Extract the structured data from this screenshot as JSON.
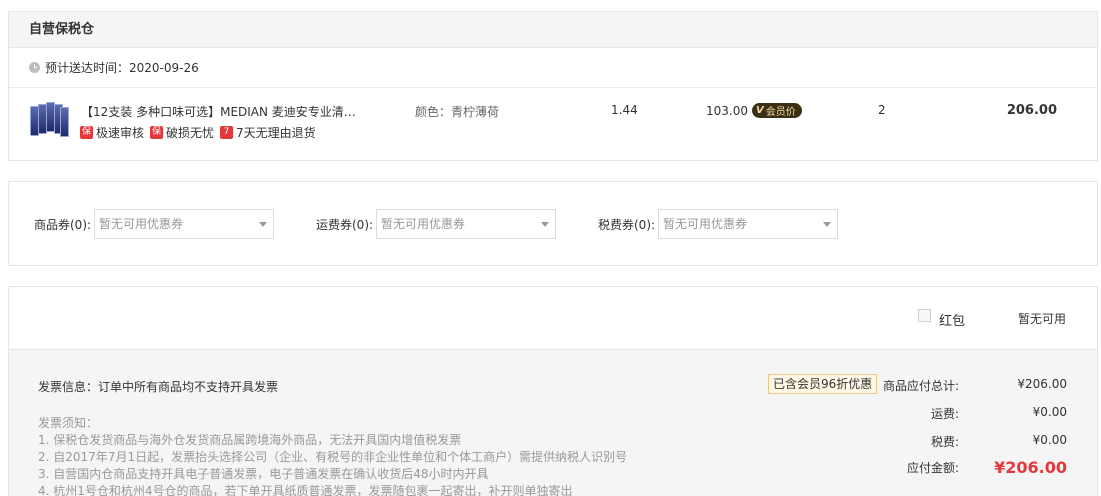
{
  "warehouse": {
    "title": "自营保税仓",
    "delivery_label": "预计送达时间：",
    "delivery_date": "2020-09-26"
  },
  "item": {
    "name": "【12支装 多种口味可选】MEDIAN 麦迪安专业清…",
    "tags": [
      {
        "icon": "保",
        "label": "极速审核"
      },
      {
        "icon": "保",
        "label": "破损无忧"
      },
      {
        "icon": "7",
        "label": "7天无理由退货"
      }
    ],
    "color": "颜色：青柠薄荷",
    "weight": "1.44",
    "price": "103.00",
    "vip_mark": "V",
    "vip_label": "会员价",
    "quantity": "2",
    "subtotal": "206.00"
  },
  "coupons": [
    {
      "label": "商品券(0):",
      "placeholder": "暂无可用优惠券"
    },
    {
      "label": "运费券(0):",
      "placeholder": "暂无可用优惠券"
    },
    {
      "label": "税费券(0):",
      "placeholder": "暂无可用优惠券"
    }
  ],
  "red_packet": {
    "label": "红包",
    "status": "暂无可用"
  },
  "invoice": {
    "info": "发票信息：订单中所有商品均不支持开具发票",
    "notice_title": "发票须知：",
    "notice_lines": [
      "1. 保税仓发货商品与海外仓发货商品属跨境海外商品，无法开具国内增值税发票",
      "2. 自2017年7月1日起，发票抬头选择公司（企业、有税号的非企业性单位和个体工商户）需提供纳税人识别号",
      "3. 自营国内仓商品支持开具电子普通发票，电子普通发票在确认收货后48小时内开具",
      "4. 杭州1号仓和杭州4号仓的商品，若下单开具纸质普通发票，发票随包裹一起寄出，补开则单独寄出"
    ]
  },
  "summary": {
    "discount_badge": "已含会员96折优惠",
    "goods_label": "商品应付总计:",
    "goods_value": "¥206.00",
    "freight_label": "运费:",
    "freight_value": "¥0.00",
    "tax_label": "税费:",
    "tax_value": "¥0.00",
    "total_label": "应付金额:",
    "total_value": "¥206.00"
  },
  "colors": {
    "accent_red": "#e4393c",
    "vip_badge_bg": "#3b2f16",
    "vip_badge_text": "#f2d9a0"
  }
}
